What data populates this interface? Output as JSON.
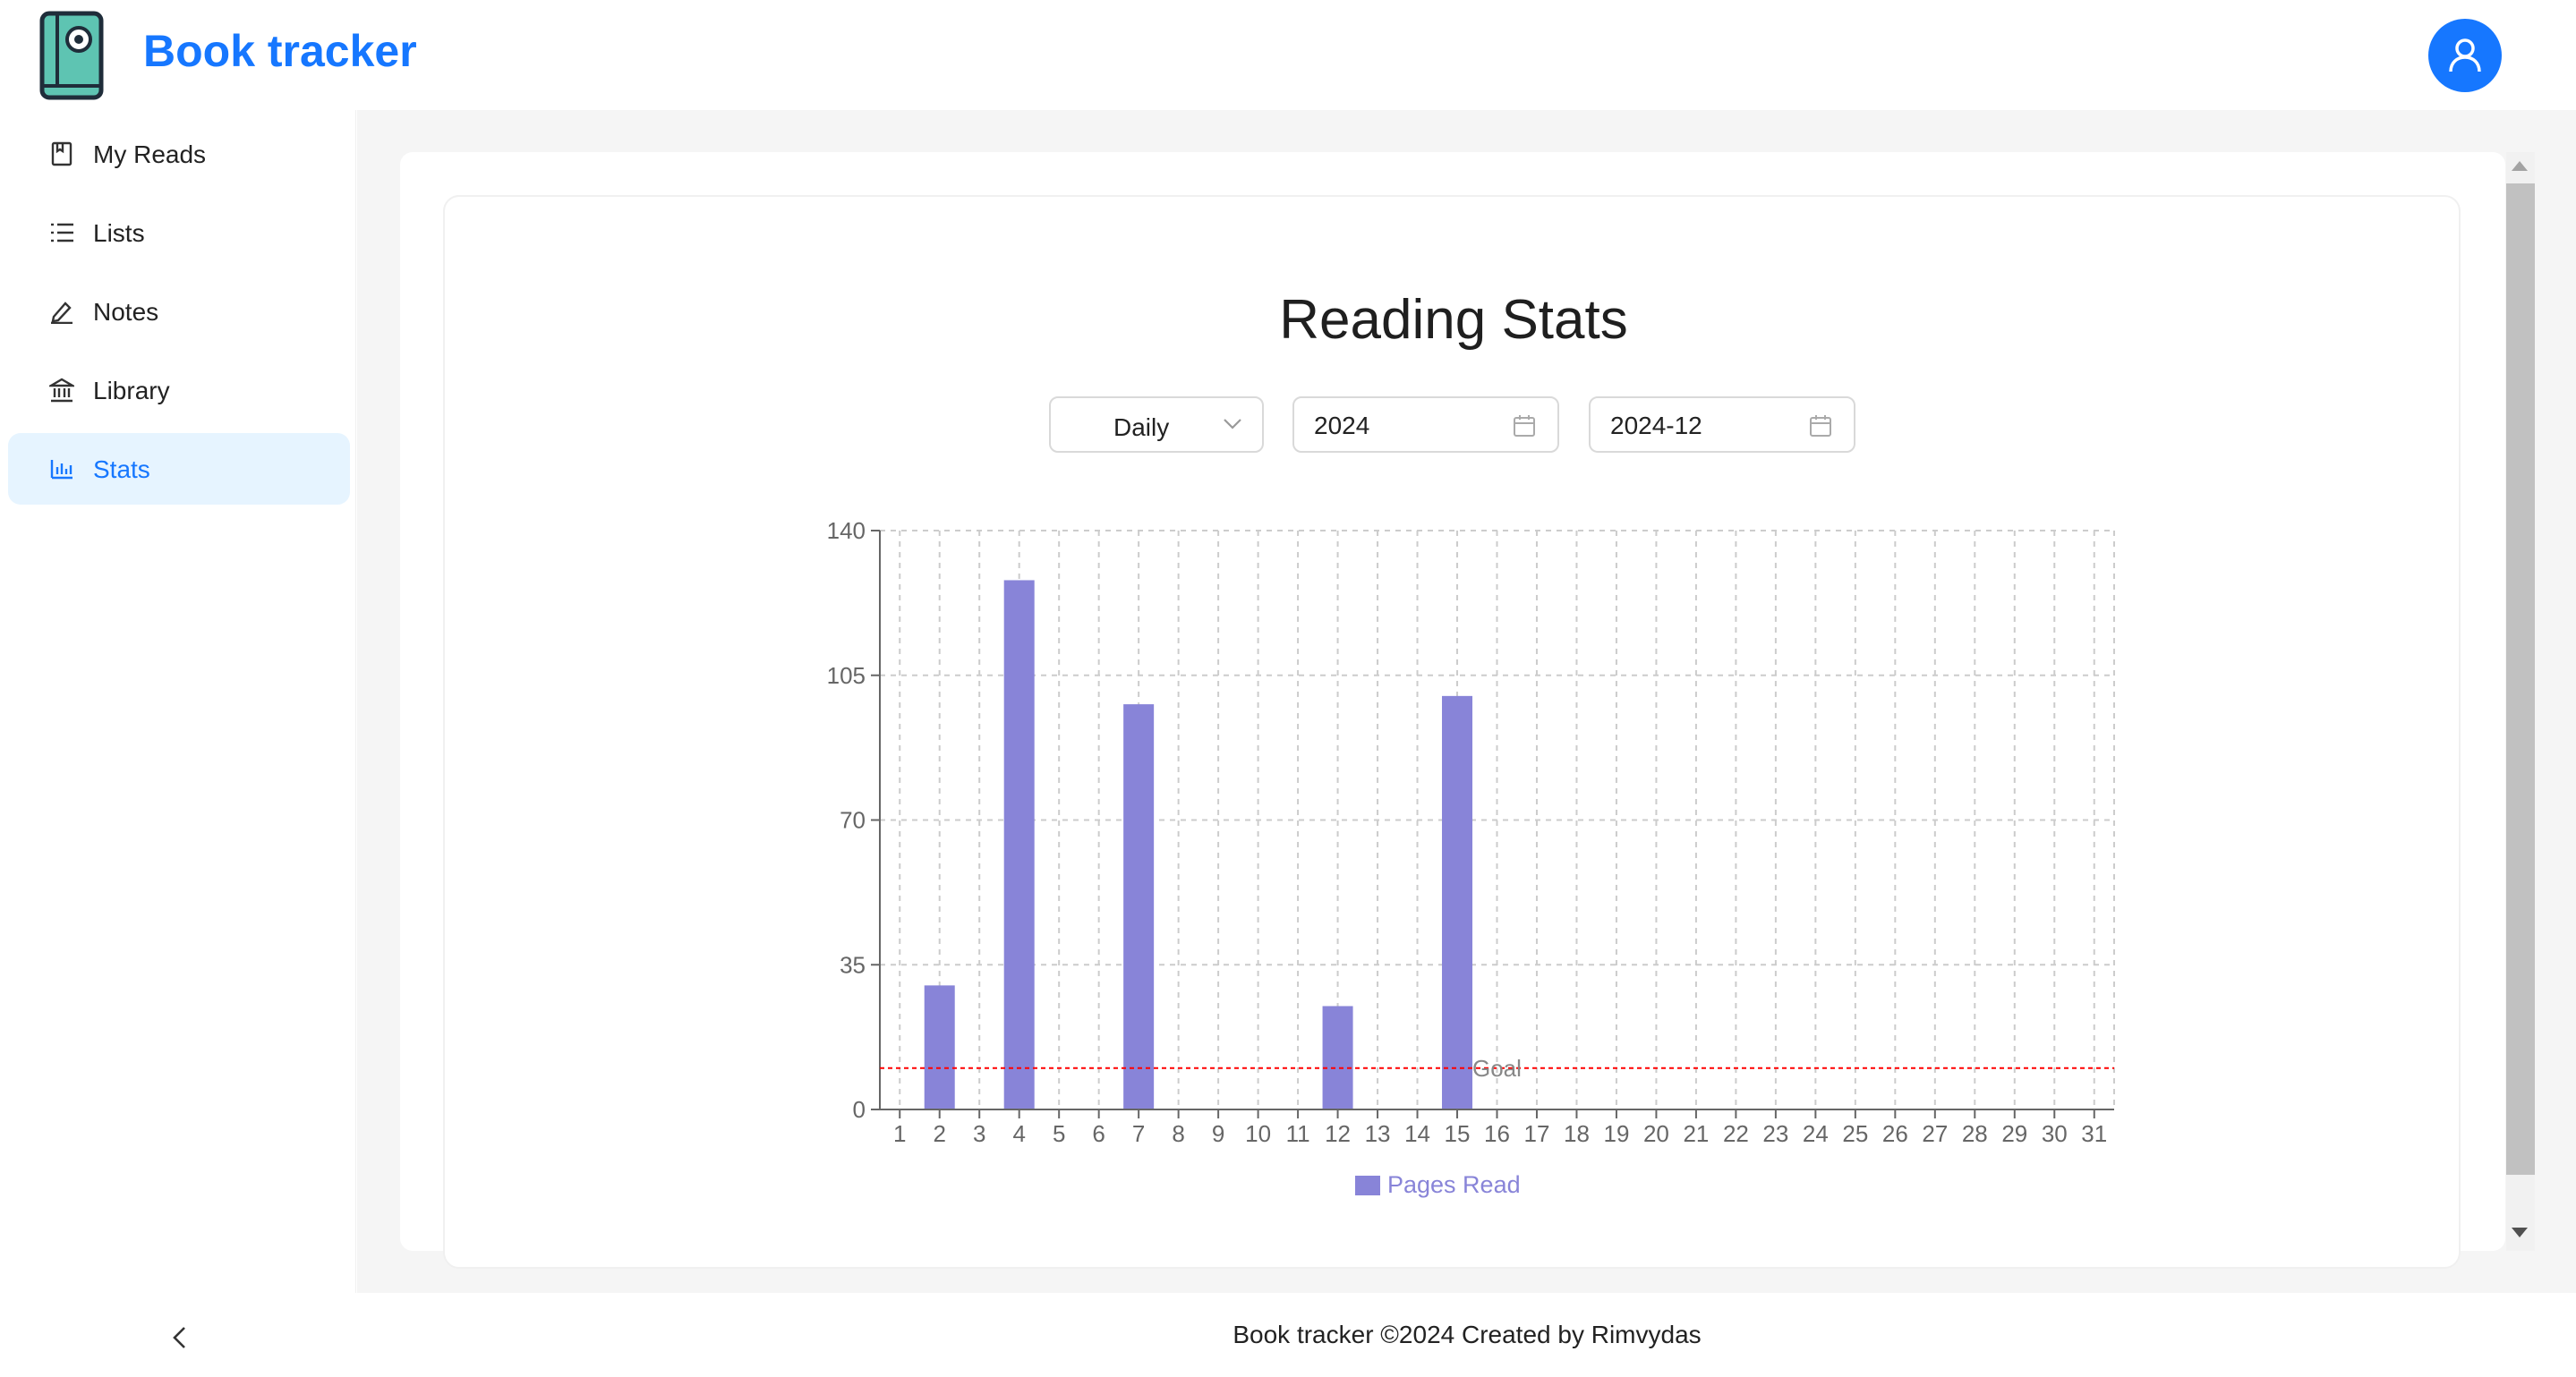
{
  "app": {
    "title": "Book tracker"
  },
  "sidebar": {
    "items": [
      {
        "label": "My Reads",
        "icon": "book-icon",
        "active": false
      },
      {
        "label": "Lists",
        "icon": "list-icon",
        "active": false
      },
      {
        "label": "Notes",
        "icon": "edit-icon",
        "active": false
      },
      {
        "label": "Library",
        "icon": "bank-icon",
        "active": false
      },
      {
        "label": "Stats",
        "icon": "bar-chart-icon",
        "active": true
      }
    ]
  },
  "main": {
    "title": "Reading Stats",
    "period_select": {
      "value": "Daily"
    },
    "year_picker": {
      "value": "2024"
    },
    "month_picker": {
      "value": "2024-12"
    }
  },
  "chart_data": {
    "type": "bar",
    "categories": [
      "1",
      "2",
      "3",
      "4",
      "5",
      "6",
      "7",
      "8",
      "9",
      "10",
      "11",
      "12",
      "13",
      "14",
      "15",
      "16",
      "17",
      "18",
      "19",
      "20",
      "21",
      "22",
      "23",
      "24",
      "25",
      "26",
      "27",
      "28",
      "29",
      "30",
      "31"
    ],
    "series": [
      {
        "name": "Pages Read",
        "color": "#8884d8",
        "values": [
          0,
          30,
          0,
          128,
          0,
          0,
          98,
          0,
          0,
          0,
          0,
          25,
          0,
          0,
          100,
          0,
          0,
          0,
          0,
          0,
          0,
          0,
          0,
          0,
          0,
          0,
          0,
          0,
          0,
          0,
          0
        ]
      }
    ],
    "ylim": [
      0,
      140
    ],
    "yticks": [
      "0",
      "35",
      "70",
      "105",
      "140"
    ],
    "reference_line": {
      "label": "Goal",
      "value": 10,
      "color": "#ff0000"
    },
    "grid": true,
    "legend": "bottom"
  },
  "footer": {
    "text": "Book tracker ©2024 Created by Rimvydas"
  },
  "colors": {
    "accent": "#1677ff",
    "active_bg": "#e6f4ff",
    "bar": "#8884d8"
  }
}
